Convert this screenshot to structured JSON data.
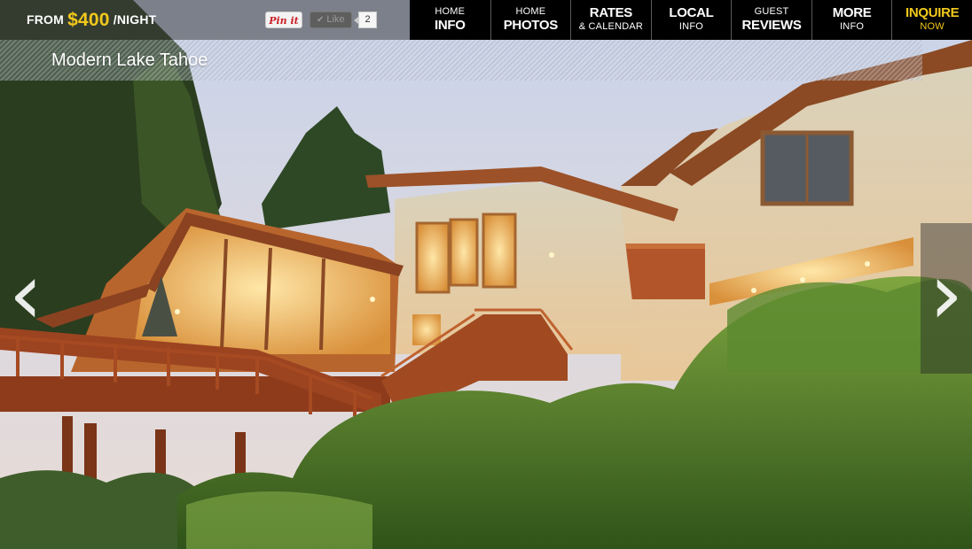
{
  "price": {
    "prefix": "FROM",
    "amount": "$400",
    "suffix": "/NIGHT"
  },
  "social": {
    "pin_label": "Pin it",
    "like_label": "Like",
    "like_count": "2"
  },
  "nav": [
    {
      "small": "HOME",
      "large": "INFO",
      "order": "small-first"
    },
    {
      "small": "HOME",
      "large": "PHOTOS",
      "order": "small-first"
    },
    {
      "small": "& CALENDAR",
      "large": "RATES",
      "order": "large-first"
    },
    {
      "small": "INFO",
      "large": "LOCAL",
      "order": "large-first"
    },
    {
      "small": "GUEST",
      "large": "REVIEWS",
      "order": "small-first"
    },
    {
      "small": "INFO",
      "large": "MORE",
      "order": "large-first"
    },
    {
      "small": "NOW",
      "large": "INQUIRE",
      "order": "large-first"
    }
  ],
  "property": {
    "title": "Modern Lake Tahoe"
  },
  "slider": {
    "prev_icon": "chevron-left-icon",
    "next_icon": "chevron-right-icon",
    "prev_glyph": "‹",
    "next_glyph": "›"
  },
  "colors": {
    "accent": "#f2c91c",
    "nav_bg": "#000000"
  }
}
